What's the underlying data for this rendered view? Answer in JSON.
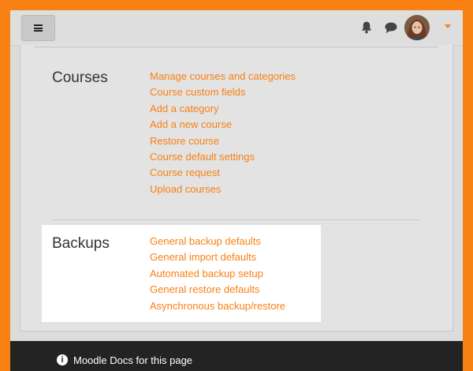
{
  "navbar": {
    "menu_icon": "hamburger-icon",
    "notification_icon": "bell-icon",
    "messages_icon": "chat-bubble-icon",
    "user_menu_icon": "caret-down-icon"
  },
  "sections": {
    "courses": {
      "title": "Courses",
      "links": [
        "Manage courses and categories",
        "Course custom fields",
        "Add a category",
        "Add a new course",
        "Restore course",
        "Course default settings",
        "Course request",
        "Upload courses"
      ]
    },
    "backups": {
      "title": "Backups",
      "links": [
        "General backup defaults",
        "General import defaults",
        "Automated backup setup",
        "General restore defaults",
        "Asynchronous backup/restore"
      ]
    }
  },
  "footer": {
    "docs_link": "Moodle Docs for this page",
    "info_icon": "info-icon"
  },
  "colors": {
    "brand": "#f98012",
    "footer_bg": "#232323"
  }
}
